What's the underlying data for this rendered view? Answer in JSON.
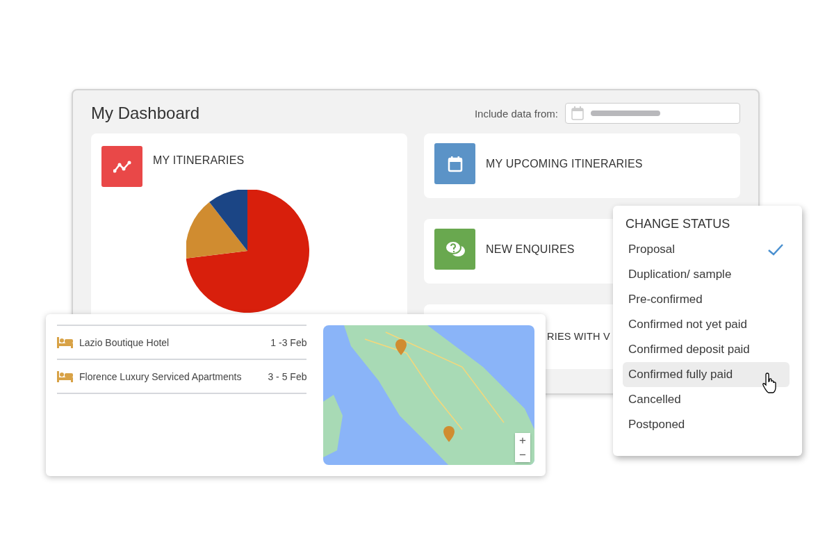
{
  "dashboard": {
    "title": "My Dashboard",
    "date_filter": {
      "label": "Include data from:"
    },
    "cards": [
      {
        "kind": "chart",
        "title": "MY ITINERARIES",
        "color": "#e94848"
      },
      {
        "kind": "stat",
        "title": "MY UPCOMING ITINERARIES",
        "color": "#5b93c7"
      },
      {
        "kind": "stat",
        "title": "NEW ENQUIRES",
        "color": "#69a84f"
      },
      {
        "kind": "partial",
        "title": "RIES WITH V"
      }
    ]
  },
  "bookings": {
    "rows": [
      {
        "name": "Lazio Boutique Hotel",
        "dates": "1 -3 Feb"
      },
      {
        "name": "Florence Luxury Serviced Apartments",
        "dates": "3 - 5 Feb"
      }
    ],
    "map": {
      "zoom_in": "+",
      "zoom_out": "−"
    }
  },
  "status_menu": {
    "title": "CHANGE STATUS",
    "items": [
      {
        "label": "Proposal",
        "selected": true,
        "highlighted": false
      },
      {
        "label": "Duplication/ sample",
        "selected": false,
        "highlighted": false
      },
      {
        "label": "Pre-confirmed",
        "selected": false,
        "highlighted": false
      },
      {
        "label": "Confirmed not yet paid",
        "selected": false,
        "highlighted": false
      },
      {
        "label": "Confirmed deposit paid",
        "selected": false,
        "highlighted": false
      },
      {
        "label": "Confirmed fully paid",
        "selected": false,
        "highlighted": true
      },
      {
        "label": "Cancelled",
        "selected": false,
        "highlighted": false
      },
      {
        "label": "Postponed",
        "selected": false,
        "highlighted": false
      }
    ]
  }
}
